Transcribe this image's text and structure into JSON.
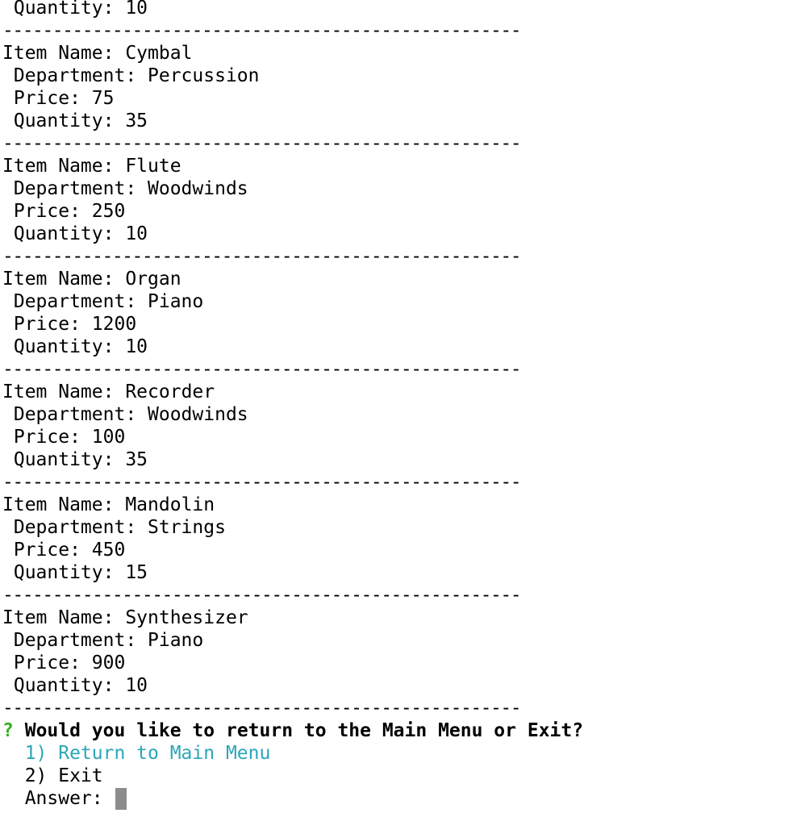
{
  "first_line": " Quantity: 10",
  "separator": "----------------------------------------------------",
  "labels": {
    "item_name": "Item Name: ",
    "department": " Department: ",
    "price": " Price: ",
    "quantity": " Quantity: "
  },
  "items": [
    {
      "name": "Cymbal",
      "department": "Percussion",
      "price": "75",
      "quantity": "35"
    },
    {
      "name": "Flute",
      "department": "Woodwinds",
      "price": "250",
      "quantity": "10"
    },
    {
      "name": "Organ",
      "department": "Piano",
      "price": "1200",
      "quantity": "10"
    },
    {
      "name": "Recorder",
      "department": "Woodwinds",
      "price": "100",
      "quantity": "35"
    },
    {
      "name": "Mandolin",
      "department": "Strings",
      "price": "450",
      "quantity": "15"
    },
    {
      "name": "Synthesizer",
      "department": "Piano",
      "price": "900",
      "quantity": "10"
    }
  ],
  "prompt": {
    "marker": "?",
    "question": "Would you like to return to the Main Menu or Exit?",
    "choices": [
      "  1) Return to Main Menu",
      "  2) Exit"
    ],
    "selected_index": 0,
    "answer_label": "  Answer: "
  },
  "colors": {
    "prompt_marker": "#2fb41d",
    "selected_choice": "#2aa7b8",
    "cursor": "#8c8c8c"
  }
}
